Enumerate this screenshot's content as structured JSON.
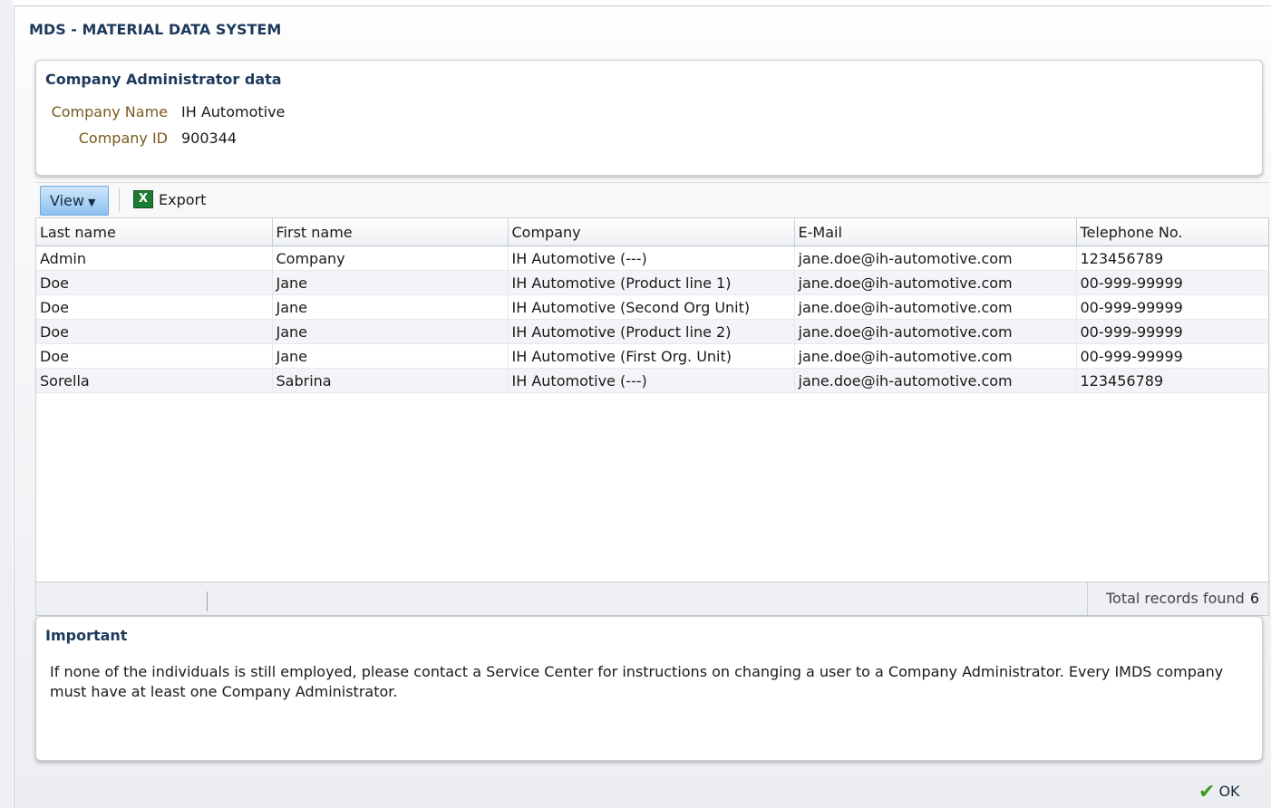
{
  "dialog": {
    "title": "MDS - MATERIAL DATA SYSTEM"
  },
  "admin_panel": {
    "title": "Company Administrator data",
    "company_name_label": "Company Name",
    "company_name": "IH Automotive",
    "company_id_label": "Company ID",
    "company_id": "900344"
  },
  "toolbar": {
    "view_label": "View",
    "view_icon": "caret-down-icon",
    "export_label": "Export",
    "export_icon": "excel-icon"
  },
  "table": {
    "columns": [
      "Last name",
      "First name",
      "Company",
      "E-Mail",
      "Telephone No."
    ],
    "rows": [
      [
        "Admin",
        "Company",
        "IH Automotive (---)",
        "jane.doe@ih-automotive.com",
        "123456789"
      ],
      [
        "Doe",
        "Jane",
        "IH Automotive (Product line 1)",
        "jane.doe@ih-automotive.com",
        "00-999-99999"
      ],
      [
        "Doe",
        "Jane",
        "IH Automotive (Second Org Unit)",
        "jane.doe@ih-automotive.com",
        "00-999-99999"
      ],
      [
        "Doe",
        "Jane",
        "IH Automotive (Product line 2)",
        "jane.doe@ih-automotive.com",
        "00-999-99999"
      ],
      [
        "Doe",
        "Jane",
        "IH Automotive (First Org. Unit)",
        "jane.doe@ih-automotive.com",
        "00-999-99999"
      ],
      [
        "Sorella",
        "Sabrina",
        "IH Automotive (---)",
        "jane.doe@ih-automotive.com",
        "123456789"
      ]
    ],
    "footer_label": "Total records found",
    "footer_count": "6"
  },
  "important_panel": {
    "title": "Important",
    "text": "If none of the individuals is still employed, please contact a Service Center for instructions on changing a user to a Company Administrator. Every IMDS company must have at least one Company Administrator."
  },
  "footer": {
    "ok_label": "OK",
    "ok_icon": "check-icon"
  },
  "colors": {
    "accent_blue": "#8cc2f0",
    "title_navy": "#1d3a5c",
    "label_brown": "#7a5a1e",
    "check_green": "#3c9a1e"
  }
}
